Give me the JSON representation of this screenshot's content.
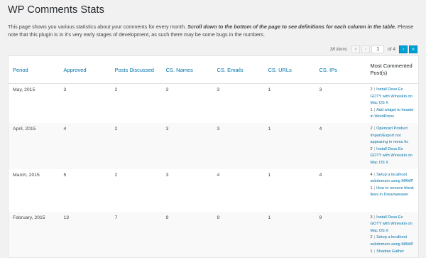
{
  "page": {
    "title": "WP Comments Stats",
    "intro_plain": "This page shows you various statistics about your comments for every month. ",
    "intro_emph": "Scroll down to the bottom of the page to see definitions for each column in the table.",
    "intro_rest": " Please note that this plugin is in it's very early stages of development, as such there may be some bugs in the numbers."
  },
  "pagination": {
    "items": "38 items",
    "first": "«",
    "prev": "‹",
    "current": "1",
    "of": "of 4",
    "next": "›",
    "last": "»"
  },
  "columns": [
    "Period",
    "Approved",
    "Posts Discussed",
    "CS. Names",
    "CS. Emails",
    "CS. URLs",
    "CS. IPs",
    "Most Commented Post(s)"
  ],
  "rows": [
    {
      "period": "May, 2015",
      "approved": "3",
      "posts": "2",
      "names": "3",
      "emails": "3",
      "urls": "1",
      "ips": "3",
      "most": [
        {
          "count": "2",
          "sep": "|",
          "title": "Install Deus Ex GOTY with Wineskin on Mac OS X"
        },
        {
          "count": "1",
          "sep": "|",
          "title": "Add widget to header in WordPress"
        }
      ]
    },
    {
      "period": "April, 2015",
      "approved": "4",
      "posts": "2",
      "names": "3",
      "emails": "3",
      "urls": "1",
      "ips": "4",
      "most": [
        {
          "count": "2",
          "sep": "|",
          "title": "Opencart Product Import/Export not appearing in menu fix"
        },
        {
          "count": "2",
          "sep": "|",
          "title": "Install Deus Ex GOTY with Wineskin on Mac OS X"
        }
      ]
    },
    {
      "period": "March, 2015",
      "approved": "5",
      "posts": "2",
      "names": "3",
      "emails": "4",
      "urls": "1",
      "ips": "4",
      "most": [
        {
          "count": "4",
          "sep": "|",
          "title": "Setup a localhost subdomain using MAMP"
        },
        {
          "count": "1",
          "sep": "|",
          "title": "How to remove blank lines in Dreamweaver"
        }
      ]
    },
    {
      "period": "February, 2015",
      "approved": "13",
      "posts": "7",
      "names": "9",
      "emails": "9",
      "urls": "1",
      "ips": "9",
      "most": [
        {
          "count": "3",
          "sep": "|",
          "title": "Install Deus Ex GOTY with Wineskin on Mac OS X"
        },
        {
          "count": "2",
          "sep": "|",
          "title": "Setup a localhost subdomain using MAMP"
        },
        {
          "count": "1",
          "sep": "|",
          "title": "Shadow Gather"
        }
      ]
    }
  ]
}
